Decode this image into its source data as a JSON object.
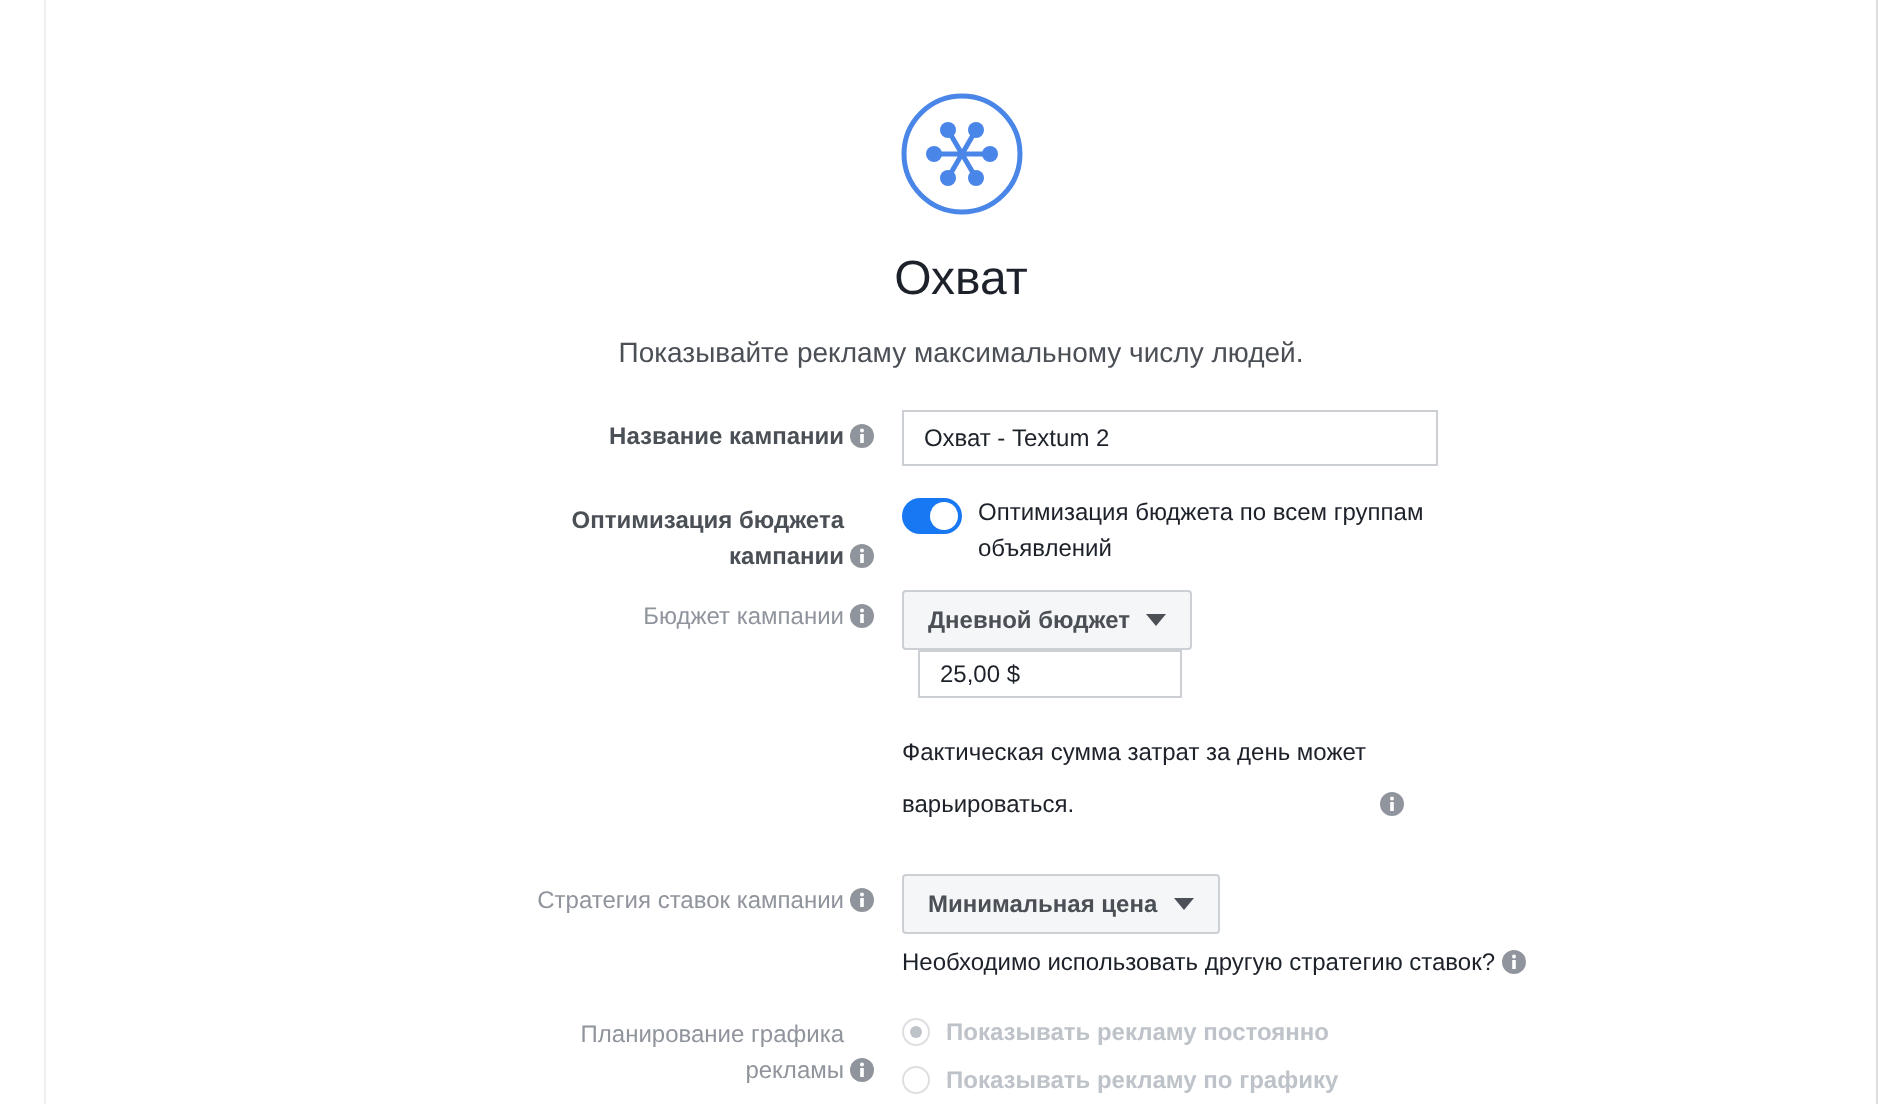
{
  "header": {
    "title": "Охват",
    "subtitle": "Показывайте рекламу максимальному числу людей."
  },
  "rows": [
    {
      "kind": "text",
      "label": "Название кампании",
      "bold": true,
      "value": "Охват - Textum 2"
    },
    {
      "kind": "toggle",
      "label": "Оптимизация бюджета кампании",
      "bold": true,
      "on": true,
      "text": "Оптимизация бюджета по всем группам объявлений"
    },
    {
      "kind": "budget",
      "label": "Бюджет кампании",
      "bold": false,
      "dropdown": "Дневной бюджет",
      "value": "25,00 $",
      "note": "Фактическая сумма затрат за день может варьироваться."
    },
    {
      "kind": "bid",
      "label": "Стратегия ставок кампании",
      "bold": false,
      "dropdown": "Минимальная цена",
      "note": "Необходимо использовать другую стратегию ставок?"
    },
    {
      "kind": "radios",
      "label": "Планирование графика рекламы",
      "bold": false,
      "options": [
        {
          "label": "Показывать рекламу постоянно",
          "selected": true,
          "disabled": true
        },
        {
          "label": "Показывать рекламу по графику",
          "selected": false,
          "disabled": true
        }
      ]
    }
  ]
}
